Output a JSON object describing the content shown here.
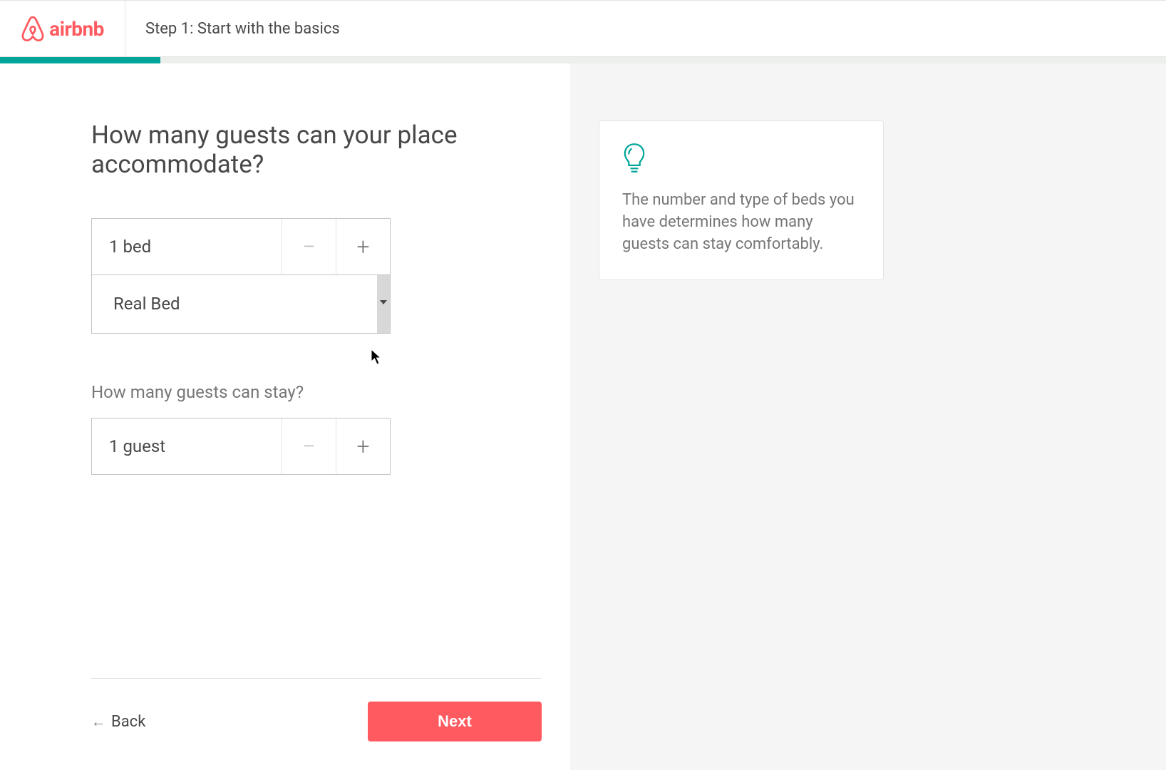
{
  "brand": {
    "name": "airbnb",
    "color": "#ff5a5f"
  },
  "header": {
    "step_title": "Step 1: Start with the basics"
  },
  "progress": {
    "percent": 16
  },
  "main": {
    "heading": "How many guests can your place accommodate?",
    "bed_stepper": {
      "value_label": "1 bed",
      "minus": "−",
      "plus": "+"
    },
    "bed_type_select": {
      "selected": "Real Bed"
    },
    "guests_label": "How many guests can stay?",
    "guests_stepper": {
      "value_label": "1 guest",
      "minus": "−",
      "plus": "+"
    }
  },
  "footer": {
    "back_label": "Back",
    "next_label": "Next"
  },
  "tip": {
    "text": "The number and type of beds you have determines how many guests can stay comfortably."
  }
}
